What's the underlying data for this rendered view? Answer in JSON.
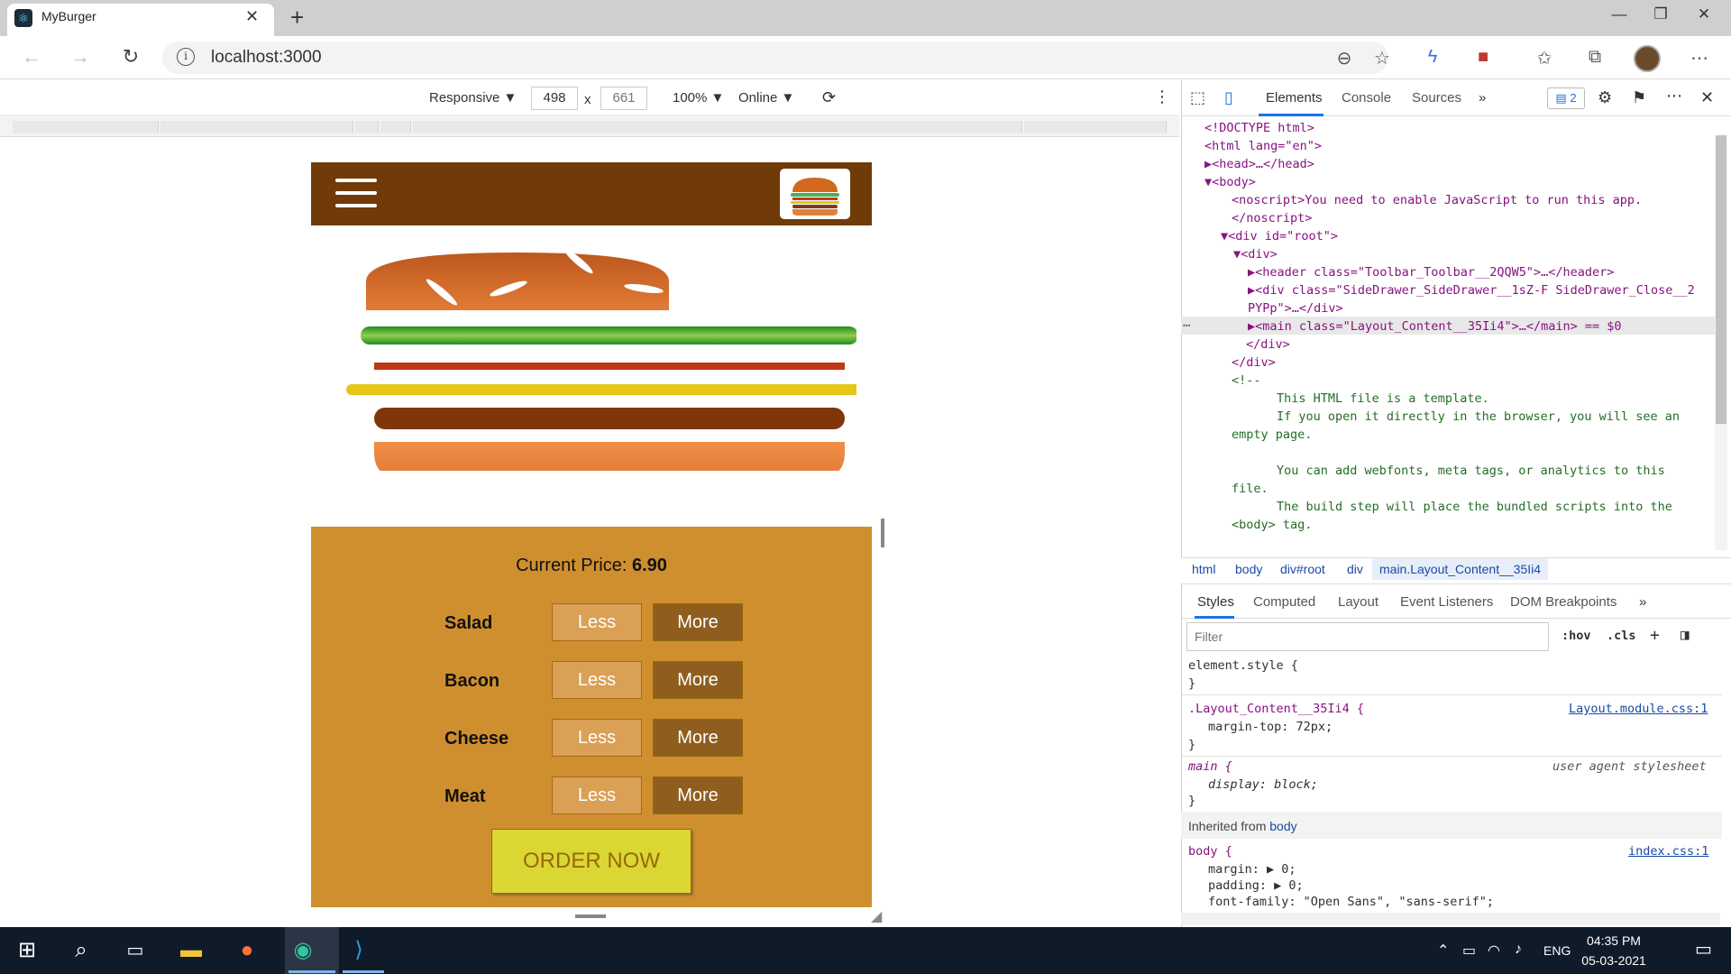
{
  "browser": {
    "tab_title": "MyBurger",
    "url": "localhost:3000"
  },
  "device_toolbar": {
    "mode": "Responsive ▼",
    "width": "498",
    "height": "661",
    "times": "x",
    "zoom": "100% ▼",
    "network": "Online ▼"
  },
  "app": {
    "price_label": "Current Price: ",
    "price_value": "6.90",
    "controls": [
      {
        "label": "Salad",
        "less": "Less",
        "more": "More"
      },
      {
        "label": "Bacon",
        "less": "Less",
        "more": "More"
      },
      {
        "label": "Cheese",
        "less": "Less",
        "more": "More"
      },
      {
        "label": "Meat",
        "less": "Less",
        "more": "More"
      }
    ],
    "order_button": "ORDER NOW",
    "colors": {
      "toolbar": "#703b09",
      "controls_bg": "#cf8f2e",
      "order": "#dad735"
    }
  },
  "devtools": {
    "tabs": [
      "Elements",
      "Console",
      "Sources",
      "»"
    ],
    "issues_count": "2",
    "dom_lines": [
      "<!DOCTYPE html>",
      "<html lang=\"en\">",
      "▶<head>…</head>",
      "▼<body>",
      "<noscript>You need to enable JavaScript to run this app.",
      "</noscript>",
      "▼<div id=\"root\">",
      "▼<div>",
      "▶<header class=\"Toolbar_Toolbar__2QQW5\">…</header>",
      "▶<div class=\"SideDrawer_SideDrawer__1sZ-F SideDrawer_Close__2",
      "PYPp\">…</div>",
      "▶<main class=\"Layout_Content__35Ii4\">…</main> == $0",
      "</div>",
      "</div>",
      "<!--",
      "This HTML file is a template.",
      "If you open it directly in the browser, you will see an",
      "empty page.",
      "You can add webfonts, meta tags, or analytics to this",
      "file.",
      "The build step will place the bundled scripts into the",
      "<body> tag."
    ],
    "breadcrumbs": [
      "html",
      "body",
      "div#root",
      "div",
      "main.Layout_Content__35Ii4"
    ],
    "style_tabs": [
      "Styles",
      "Computed",
      "Layout",
      "Event Listeners",
      "DOM Breakpoints",
      "»"
    ],
    "filter_placeholder": "Filter",
    "hov": ":hov",
    "cls": ".cls",
    "rules": {
      "element_style_open": "element.style {",
      "close": "}",
      "layout_selector": ".Layout_Content__35Ii4 {",
      "layout_source": "Layout.module.css:1",
      "layout_decl": "margin-top: 72px;",
      "main_selector": "main {",
      "main_source": "user agent stylesheet",
      "main_decl": "display: block;",
      "inherited_label": "Inherited from ",
      "inherited_link": "body",
      "body_selector": "body {",
      "body_source": "index.css:1",
      "body_margin": "margin: ▶ 0;",
      "body_padding": "padding: ▶ 0;",
      "body_font": "font-family: \"Open Sans\", \"sans-serif\";"
    }
  },
  "taskbar": {
    "language": "ENG",
    "time": "04:35 PM",
    "date": "05-03-2021"
  }
}
